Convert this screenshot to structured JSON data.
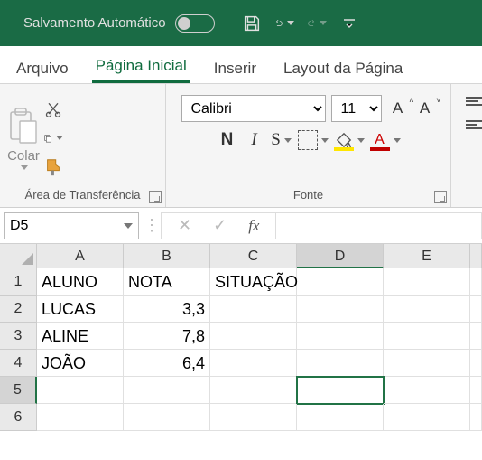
{
  "titlebar": {
    "autosave_label": "Salvamento Automático"
  },
  "tabs": {
    "arquivo": "Arquivo",
    "pagina_inicial": "Página Inicial",
    "inserir": "Inserir",
    "layout": "Layout da Página"
  },
  "ribbon": {
    "clipboard_group": "Área de Transferência",
    "paste_label": "Colar",
    "font_group": "Fonte",
    "font_name": "Calibri",
    "font_size": "11"
  },
  "formula_bar": {
    "cell_ref": "D5",
    "fx_label": "fx",
    "formula_value": ""
  },
  "columns": [
    "A",
    "B",
    "C",
    "D",
    "E",
    ""
  ],
  "row_numbers": [
    "1",
    "2",
    "3",
    "4",
    "5",
    "6"
  ],
  "cells": {
    "A1": "ALUNO",
    "B1": "NOTA",
    "C1": "SITUAÇÃO",
    "A2": "LUCAS",
    "B2": "3,3",
    "A3": "ALINE",
    "B3": "7,8",
    "A4": "JOÃO",
    "B4": "6,4"
  },
  "active_cell": "D5",
  "chart_data": {
    "type": "table",
    "columns": [
      "ALUNO",
      "NOTA",
      "SITUAÇÃO"
    ],
    "rows": [
      {
        "ALUNO": "LUCAS",
        "NOTA": 3.3,
        "SITUAÇÃO": ""
      },
      {
        "ALUNO": "ALINE",
        "NOTA": 7.8,
        "SITUAÇÃO": ""
      },
      {
        "ALUNO": "JOÃO",
        "NOTA": 6.4,
        "SITUAÇÃO": ""
      }
    ]
  }
}
